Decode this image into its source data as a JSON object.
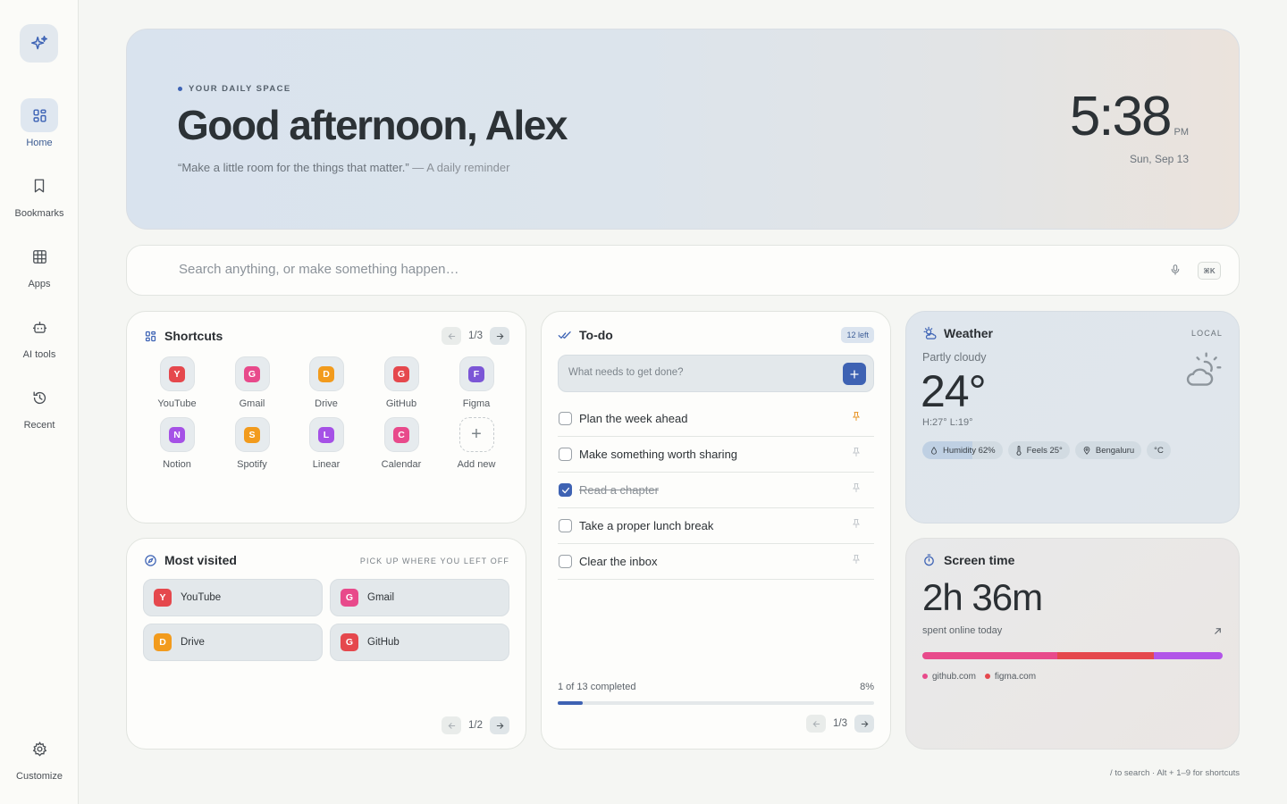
{
  "sidebar": {
    "items": [
      {
        "label": "Home",
        "icon": "grid-icon",
        "active": true
      },
      {
        "label": "Bookmarks",
        "icon": "bookmark-icon",
        "active": false
      },
      {
        "label": "Apps",
        "icon": "apps-icon",
        "active": false
      },
      {
        "label": "AI tools",
        "icon": "robot-icon",
        "active": false
      },
      {
        "label": "Recent",
        "icon": "history-icon",
        "active": false
      }
    ],
    "customize_label": "Customize"
  },
  "hero": {
    "tag": "YOUR DAILY SPACE",
    "greeting": "Good afternoon, Alex",
    "quote": "“Make a little room for the things that matter.”",
    "quote_author": "— A daily reminder",
    "time": "5:38",
    "ampm": "PM",
    "date": "Sun, Sep 13"
  },
  "search": {
    "placeholder": "Search anything, or make something happen…",
    "shortcut": "⌘K"
  },
  "shortcuts": {
    "title": "Shortcuts",
    "page": "1/3",
    "items": [
      {
        "label": "YouTube",
        "letter": "Y",
        "color": "#e5484d"
      },
      {
        "label": "Gmail",
        "letter": "G",
        "color": "#e84a8b"
      },
      {
        "label": "Drive",
        "letter": "D",
        "color": "#f29b1d"
      },
      {
        "label": "GitHub",
        "letter": "G",
        "color": "#e5484d"
      },
      {
        "label": "Figma",
        "letter": "F",
        "color": "#7b56d6"
      },
      {
        "label": "Notion",
        "letter": "N",
        "color": "#a551e6"
      },
      {
        "label": "Spotify",
        "letter": "S",
        "color": "#f29b1d"
      },
      {
        "label": "Linear",
        "letter": "L",
        "color": "#a551e6"
      },
      {
        "label": "Calendar",
        "letter": "C",
        "color": "#e84a8b"
      }
    ],
    "add_label": "Add new"
  },
  "most_visited": {
    "title": "Most visited",
    "subtitle": "PICK UP WHERE YOU LEFT OFF",
    "page": "1/2",
    "items": [
      {
        "label": "YouTube",
        "letter": "Y",
        "color": "#e5484d"
      },
      {
        "label": "Gmail",
        "letter": "G",
        "color": "#e84a8b"
      },
      {
        "label": "Drive",
        "letter": "D",
        "color": "#f29b1d"
      },
      {
        "label": "GitHub",
        "letter": "G",
        "color": "#e5484d"
      }
    ]
  },
  "todo": {
    "title": "To-do",
    "count": "12 left",
    "placeholder": "What needs to get done?",
    "items": [
      {
        "text": "Plan the week ahead",
        "done": false,
        "pinned": true
      },
      {
        "text": "Make something worth sharing",
        "done": false,
        "pinned": false
      },
      {
        "text": "Read a chapter",
        "done": true,
        "pinned": false
      },
      {
        "text": "Take a proper lunch break",
        "done": false,
        "pinned": false
      },
      {
        "text": "Clear the inbox",
        "done": false,
        "pinned": false
      }
    ],
    "progress_label": "1 of 13 completed",
    "progress_pct": "8%",
    "progress_value": 0.08,
    "page": "1/3"
  },
  "weather": {
    "title": "Weather",
    "scope": "LOCAL",
    "condition": "Partly cloudy",
    "temp": "24°",
    "hilo": "H:27° L:19°",
    "chips": {
      "humidity": "Humidity 62%",
      "feels": "Feels 25°",
      "location": "Bengaluru",
      "unit": "°C"
    },
    "humidity_value": 0.62
  },
  "screen_time": {
    "title": "Screen time",
    "total": "2h 36m",
    "subtitle": "spent online today",
    "segments": [
      {
        "share": 0.45,
        "color": "#e84a8b"
      },
      {
        "share": 0.32,
        "color": "#e5484d"
      },
      {
        "share": 0.23,
        "color": "#b255e8"
      }
    ],
    "legend": [
      {
        "label": "github.com",
        "color": "#e84a8b"
      },
      {
        "label": "figma.com",
        "color": "#e5484d"
      }
    ]
  },
  "footer_hint": "/ to search · Alt + 1–9 for shortcuts"
}
